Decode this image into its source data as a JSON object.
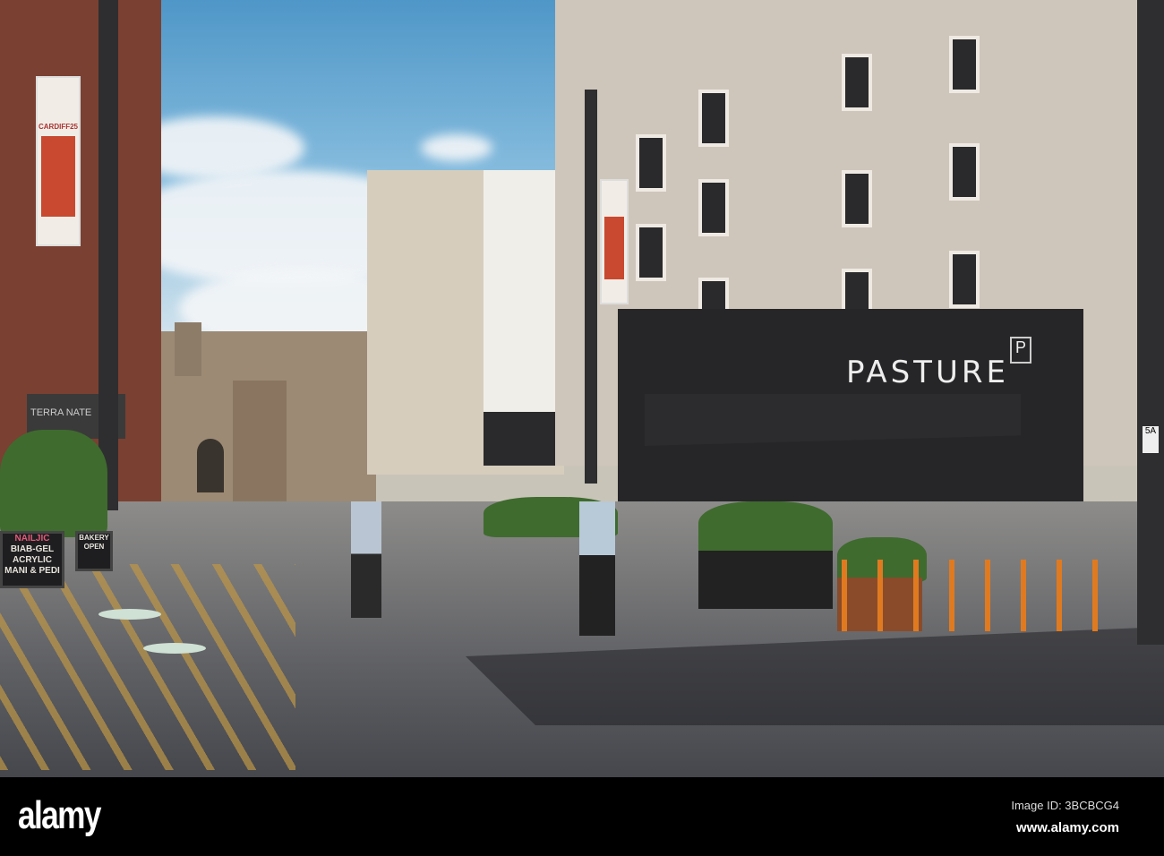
{
  "photo": {
    "shop_sign": "PASTURE",
    "shop_logo_letter": "P",
    "banner_text": "CARDIFF25",
    "left_shop_sign": "TERRA NATE",
    "chalkboard_nails": [
      "NAILJIC",
      "BIAB-GEL",
      "ACRYLIC",
      "MANI & PEDI"
    ],
    "chalkboard_bakery": [
      "BAKERY",
      "OPEN"
    ],
    "corner_marker": "5A"
  },
  "footer": {
    "logo": "alamy",
    "image_id": "Image ID: 3BCBCG4",
    "url": "www.alamy.com"
  }
}
